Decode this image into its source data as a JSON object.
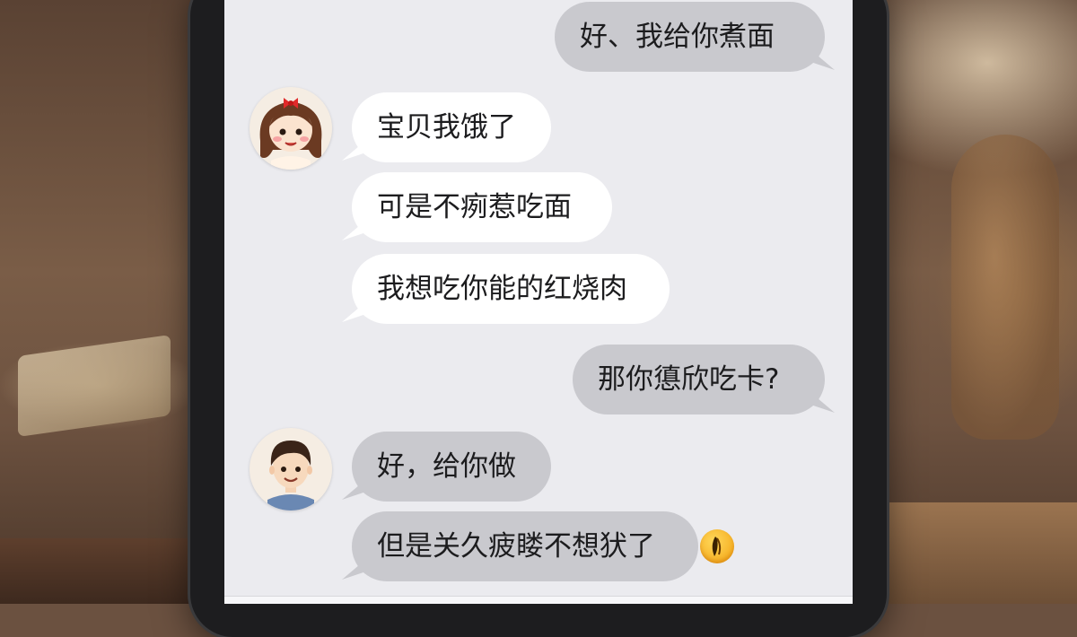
{
  "chat": {
    "messages": [
      {
        "sender": "me",
        "text": "好、我给你煮面"
      },
      {
        "sender": "girlfriend",
        "text": "宝贝我饿了"
      },
      {
        "sender": "girlfriend",
        "text": "可是不㾐惹吃面"
      },
      {
        "sender": "girlfriend",
        "text": "我想吃你能的红烧肉"
      },
      {
        "sender": "me",
        "text": "那你憄欣吃卡?"
      },
      {
        "sender": "boyfriend",
        "text": "好，给你做"
      },
      {
        "sender": "boyfriend",
        "text": "但是关久疲䁖不想犾了"
      }
    ]
  },
  "icons": {
    "girl_avatar": "girl-avatar-with-red-bow",
    "boy_avatar": "boy-avatar",
    "emoji": "crying-face-emoji"
  },
  "colors": {
    "incoming_bubble": "#ffffff",
    "outgoing_bubble": "#c9c9ce",
    "screen_background": "#ebebef"
  }
}
